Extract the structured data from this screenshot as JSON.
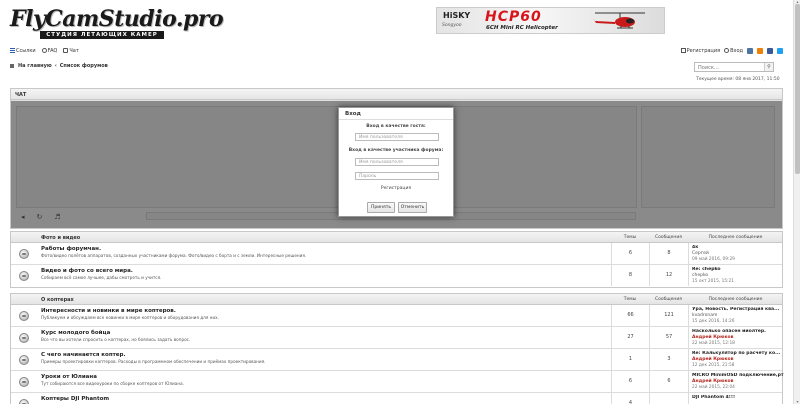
{
  "header": {
    "logo_main": "FlyCamStudio.pro",
    "logo_sub": "СТУДИЯ ЛЕТАЮЩИХ КАМЕР",
    "banner": {
      "brand": "HiSKY",
      "sub": "Songyoo",
      "model": "HCP60",
      "desc": "6CH Mini RC Helicopter"
    }
  },
  "nav": {
    "left": [
      {
        "icon": "list-icon",
        "label": "Ссылки"
      },
      {
        "icon": "help-icon",
        "label": "FAQ"
      },
      {
        "icon": "chat-icon",
        "label": "Чат"
      }
    ],
    "register": "Регистрация",
    "login": "Вход"
  },
  "breadcrumb": {
    "home": "На главную",
    "sep": "‹",
    "current": "Список форумов"
  },
  "search": {
    "placeholder": "Поиск…"
  },
  "current_time": "Текущее время: 08 янв 2017, 11:50",
  "chat": {
    "title": "ЧАТ"
  },
  "dialog": {
    "title": "Вход",
    "guest_label": "Вход в качестве гостя:",
    "guest_placeholder": "Имя пользователя",
    "member_label": "Вход в качестве участника форума:",
    "user_placeholder": "Имя пользователя",
    "pass_placeholder": "Пароль",
    "register": "Регистрация",
    "accept": "Принять",
    "cancel": "Отменить"
  },
  "categories": [
    {
      "name": "Фото и видео",
      "col_topics": "Темы",
      "col_posts": "Сообщения",
      "col_last": "Последнее сообщение",
      "forums": [
        {
          "name": "Работы форумчан.",
          "desc": "Фото/видео полётов аппаратов, созданных участниками форума. Фото/видео с борта и с земли. Интересные решения.",
          "topics": "6",
          "posts": "8",
          "last_title": "4к",
          "last_author": "Сергей",
          "last_date": "09 май 2016, 09:29",
          "red": false
        },
        {
          "name": "Видео и фото со всего мира.",
          "desc": "Собираем всё самое лучшее, дабы смотреть и учится.",
          "topics": "8",
          "posts": "12",
          "last_title": "Re: chepko",
          "last_author": "chepko",
          "last_date": "15 окт 2015, 15:21",
          "red": false
        }
      ]
    },
    {
      "name": "О коптерах",
      "col_topics": "Темы",
      "col_posts": "Сообщения",
      "col_last": "Последнее сообщение",
      "forums": [
        {
          "name": "Интересности и новинки в мире коптеров.",
          "desc": "Публикуем и обсуждаем все новинки в мире коптеров и оборудования для них.",
          "topics": "66",
          "posts": "121",
          "last_title": "Ура, Новость. Регистрация ква...",
          "last_author": "kvadronam",
          "last_date": "15 дек 2016, 14:26",
          "red": false
        },
        {
          "name": "Курс молодого бойца",
          "desc": "Все что вы хотели спросить о коптерах, но боялись задать вопрос.",
          "topics": "27",
          "posts": "57",
          "last_title": "Насколько опасен ииолтер.",
          "last_author": "Андрей Крюков",
          "last_date": "22 май 2015, 12:18",
          "red": true
        },
        {
          "name": "С чего начинается коптер.",
          "desc": "Примеры проектировки коптеров. Расходы в программном обеспечении и приёмах проектирования.",
          "topics": "1",
          "posts": "3",
          "last_title": "Re: Калькулятор по расчёту ко...",
          "last_author": "Андрей Крюков",
          "last_date": "12 дек 2015, 21:58",
          "red": true
        },
        {
          "name": "Уроки от Юлиана",
          "desc": "Тут собираются все видеоуроки по сборке коптеров от Юлиана.",
          "topics": "6",
          "posts": "6",
          "last_title": "MICRO MinimOSD подключение,рт...",
          "last_author": "Андрей Крюков",
          "last_date": "22 май 2015, 22:04",
          "red": true
        },
        {
          "name": "Коптеры DJI Phantom",
          "desc": "",
          "topics": "4",
          "posts": "",
          "last_title": "DJI Phantom 4!!!",
          "last_author": "",
          "last_date": "",
          "red": false
        }
      ]
    }
  ]
}
